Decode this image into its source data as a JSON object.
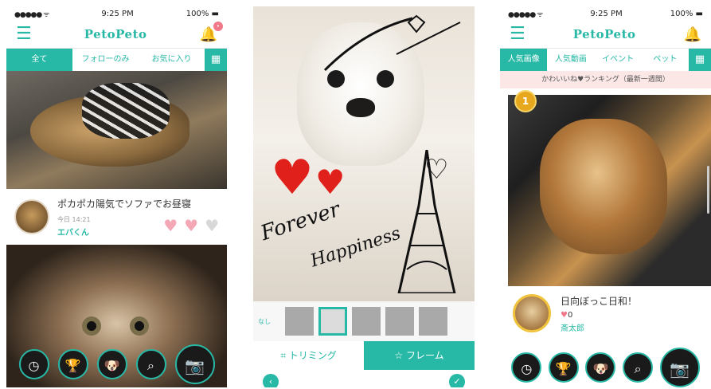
{
  "colors": {
    "accent": "#27b8a6",
    "heart_pink": "#f07a8a",
    "heart_red": "#e0201a",
    "gold": "#e7a81e"
  },
  "phone1": {
    "status": {
      "time": "9:25 PM",
      "battery": "100%"
    },
    "logo": "PetoPeto",
    "tabs": [
      "全て",
      "フォローのみ",
      "お気に入り"
    ],
    "post": {
      "title": "ポカポカ陽気でソファでお昼寝",
      "time": "今日 14:21",
      "user": "エバくん"
    }
  },
  "phone2": {
    "frames_label": "なし",
    "modes": [
      "トリミング",
      "フレーム"
    ],
    "sticker_text_1": "Forever",
    "sticker_text_2": "Happiness"
  },
  "phone3": {
    "status": {
      "time": "9:25 PM",
      "battery": "100%"
    },
    "logo": "PetoPeto",
    "tabs": [
      "人気画像",
      "人気動画",
      "イベント",
      "ペット"
    ],
    "ranking_title": "かわいいね♥ランキング（最新一週間）",
    "rank": "1",
    "post": {
      "title": "日向ぼっこ日和！",
      "likes": "0",
      "user": "斎太郎"
    }
  }
}
